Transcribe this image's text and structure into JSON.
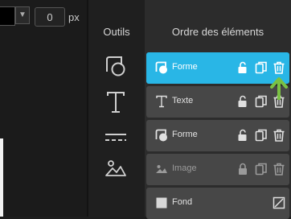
{
  "stroke": {
    "color": "#000000",
    "width_value": "0",
    "unit": "px"
  },
  "tools": {
    "title": "Outils"
  },
  "layers": {
    "title": "Ordre des éléments",
    "items": [
      {
        "label": "Forme",
        "type": "shape",
        "state": "selected"
      },
      {
        "label": "Texte",
        "type": "text",
        "state": "normal"
      },
      {
        "label": "Forme",
        "type": "shape",
        "state": "normal"
      },
      {
        "label": "Image",
        "type": "image",
        "state": "disabled"
      },
      {
        "label": "Fond",
        "type": "background",
        "state": "normal"
      }
    ]
  },
  "colors": {
    "accent": "#29b6e6",
    "highlight_arrow": "#7ac143",
    "row_bg": "#474747",
    "panel_bg": "#2c2c2c"
  },
  "icons": [
    "shape-tool-icon",
    "text-tool-icon",
    "line-tool-icon",
    "image-tool-icon",
    "unlock-icon",
    "lock-icon",
    "duplicate-icon",
    "trash-icon",
    "resize-icon"
  ]
}
